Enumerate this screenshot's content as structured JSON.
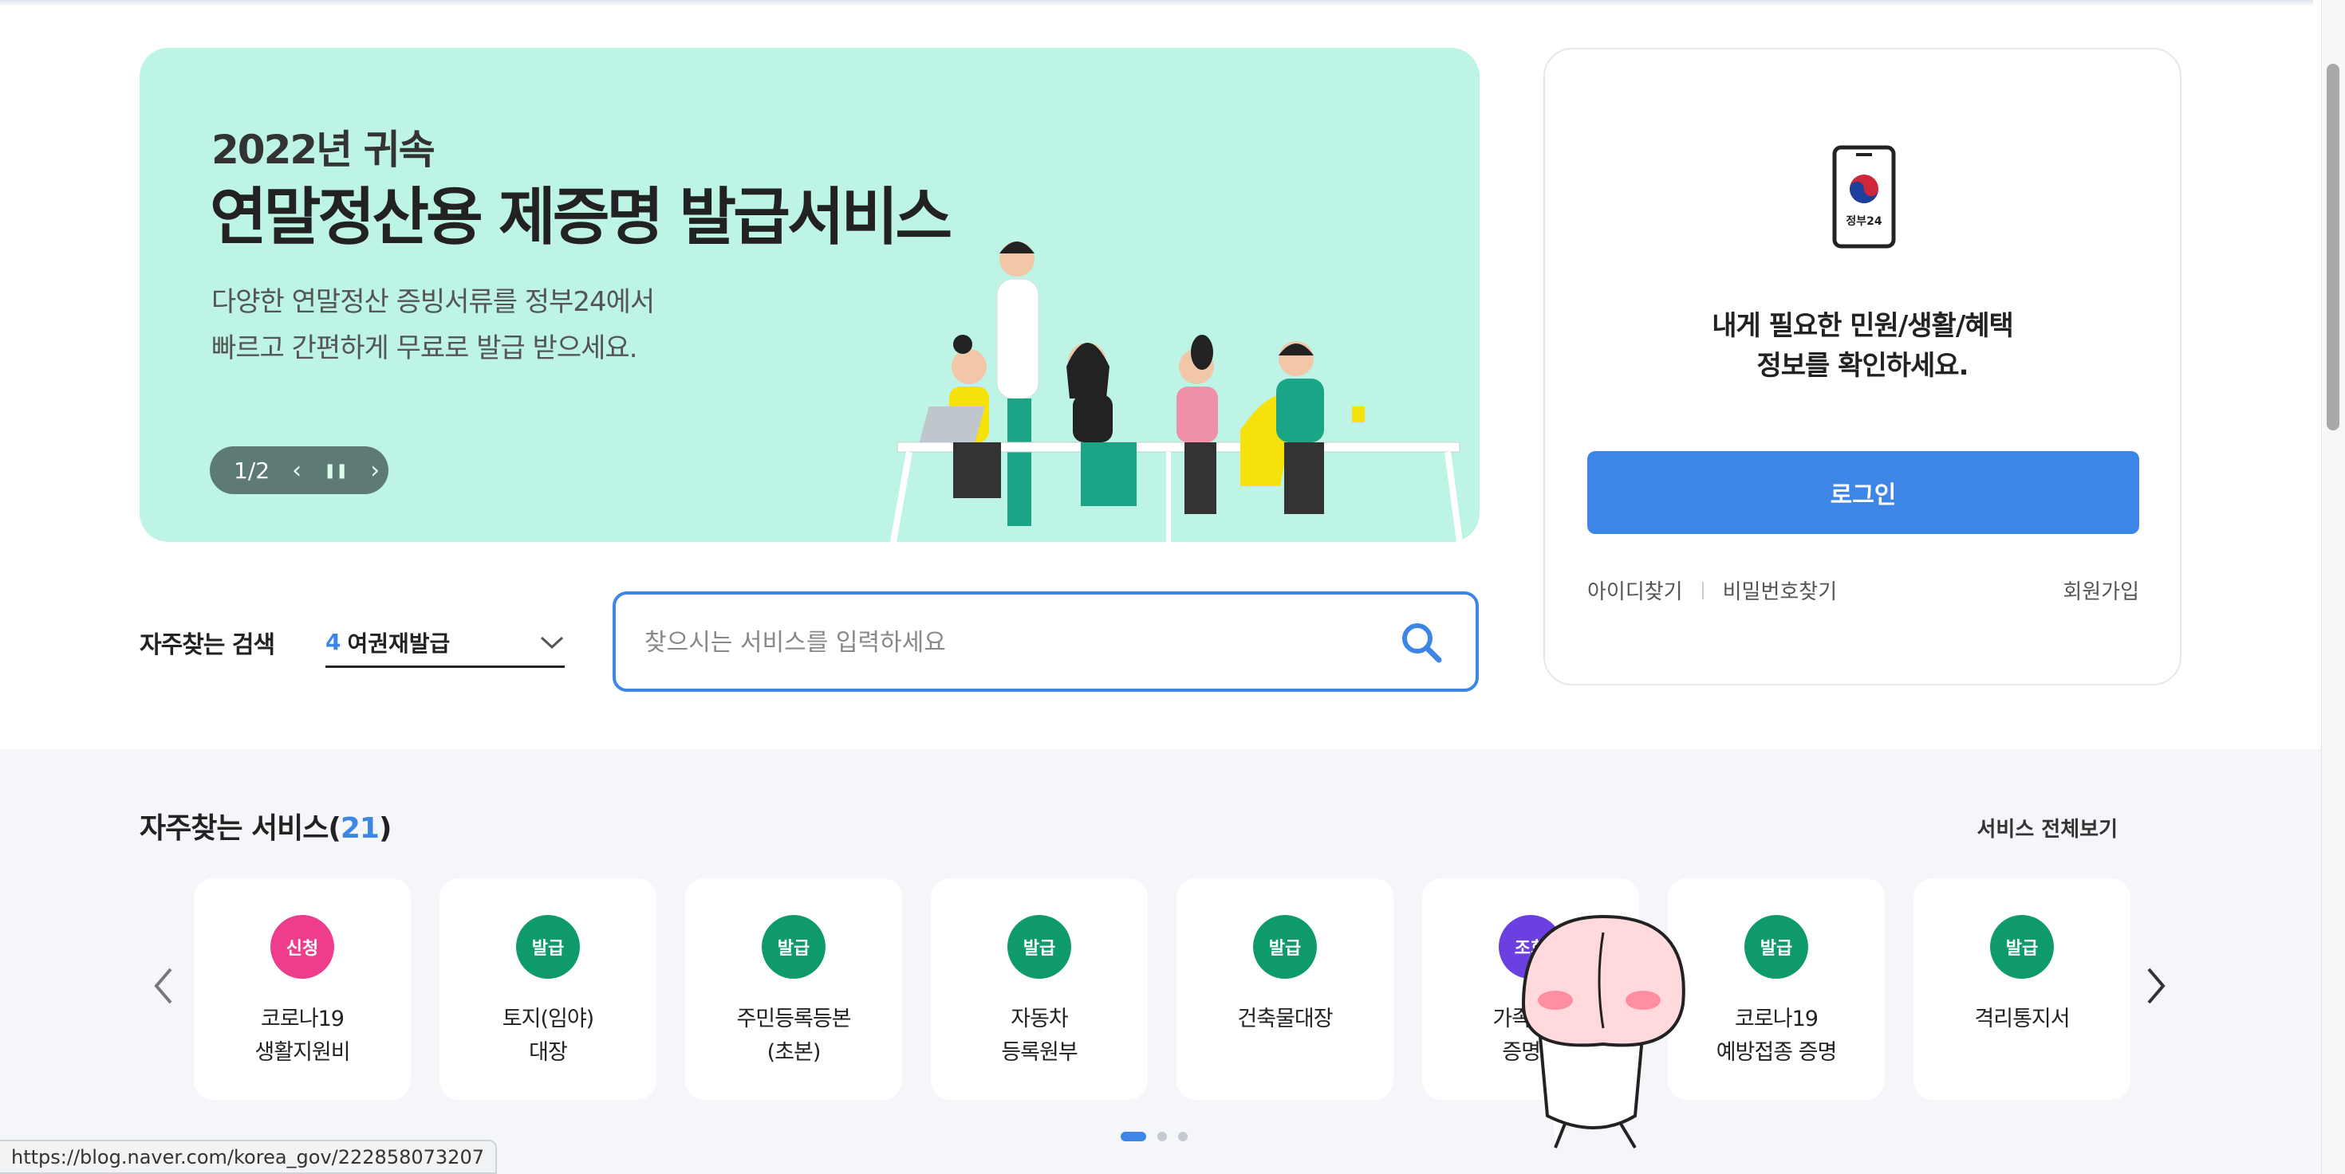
{
  "banner": {
    "year_line": "2022년 귀속",
    "headline": "연말정산용 제증명 발급서비스",
    "desc_line1": "다양한 연말정산 증빙서류를 정부24에서",
    "desc_line2": "빠르고 간편하게 무료로 발급 받으세요.",
    "pager": "1/2",
    "prev_glyph": "‹",
    "pause_glyph": "❚❚",
    "next_glyph": "›"
  },
  "login_card": {
    "logo_text": "정부24",
    "message_line1": "내게 필요한 민원/생활/혜택",
    "message_line2": "정보를 확인하세요.",
    "login_label": "로그인",
    "find_id": "아이디찾기",
    "find_password": "비밀번호찾기",
    "signup": "회원가입"
  },
  "search": {
    "freq_label": "자주찾는 검색",
    "freq_rank": "4",
    "freq_term": "여권재발급",
    "placeholder": "찾으시는 서비스를 입력하세요"
  },
  "services": {
    "title": "자주찾는 서비스(",
    "count": "21",
    "title_close": ")",
    "view_all": "서비스 전체보기",
    "cards": [
      {
        "badge": "신청",
        "badge_color": "#ee3d8c",
        "name": "코로나19\n생활지원비"
      },
      {
        "badge": "발급",
        "badge_color": "#0e9a6b",
        "name": "토지(임야)\n대장"
      },
      {
        "badge": "발급",
        "badge_color": "#0e9a6b",
        "name": "주민등록등본\n(초본)"
      },
      {
        "badge": "발급",
        "badge_color": "#0e9a6b",
        "name": "자동차\n등록원부"
      },
      {
        "badge": "발급",
        "badge_color": "#0e9a6b",
        "name": "건축물대장"
      },
      {
        "badge": "조회",
        "badge_color": "#6b3fe0",
        "name": "가족관계\n증명서"
      },
      {
        "badge": "발급",
        "badge_color": "#0e9a6b",
        "name": "코로나19\n예방접종 증명"
      },
      {
        "badge": "발급",
        "badge_color": "#0e9a6b",
        "name": "격리통지서"
      }
    ]
  },
  "status_url": "https://blog.naver.com/korea_gov/222858073207",
  "colors": {
    "accent": "#3d86e6",
    "banner_bg": "#bdf4e6",
    "section_bg": "#f4f6fa"
  }
}
